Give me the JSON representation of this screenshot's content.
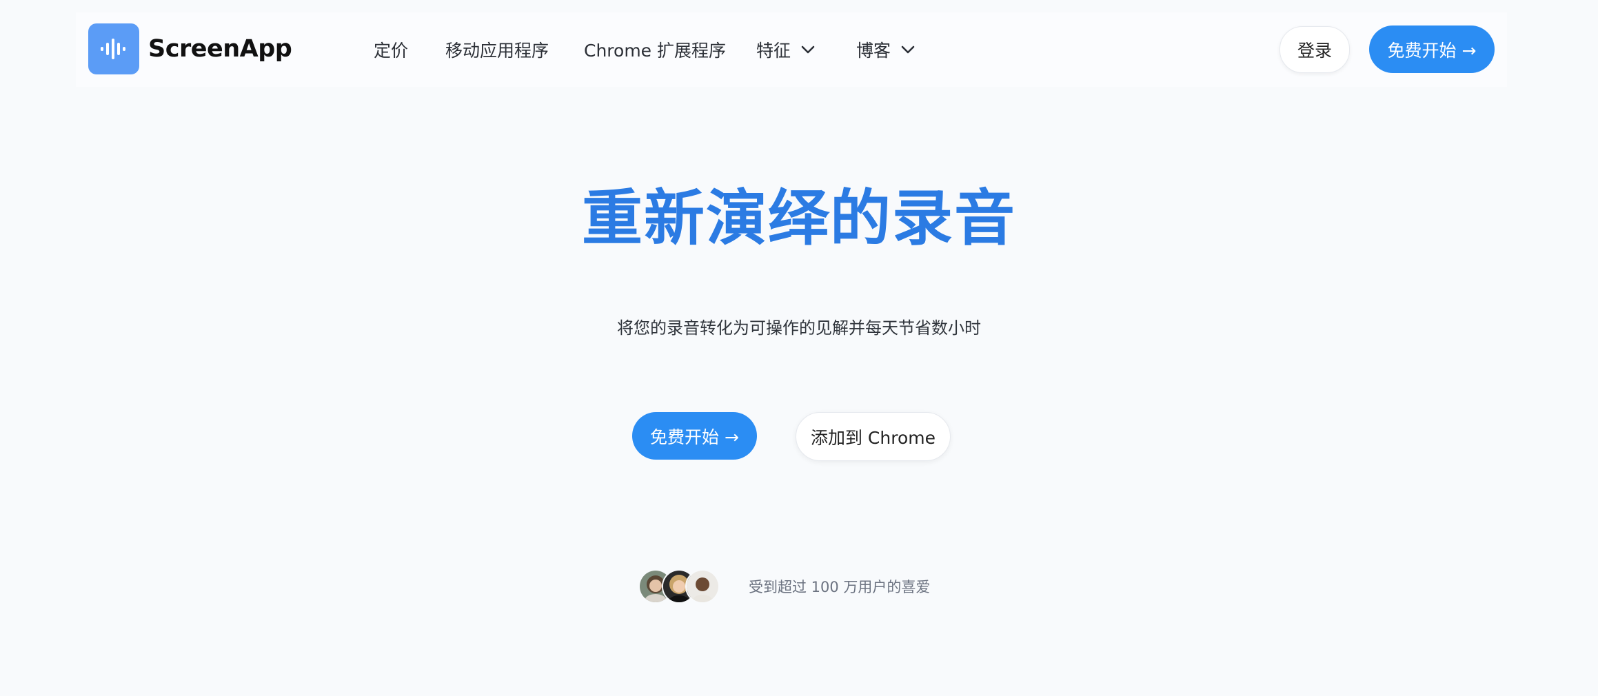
{
  "brand": {
    "name": "ScreenApp",
    "logo_icon": "waveform-icon",
    "logo_color": "#5b9cf6"
  },
  "nav": {
    "items": [
      {
        "label": "定价",
        "has_dropdown": false
      },
      {
        "label": "移动应用程序",
        "has_dropdown": false
      },
      {
        "label": "Chrome 扩展程序",
        "has_dropdown": false
      },
      {
        "label": "特征",
        "has_dropdown": true,
        "icon": "chevron-down-icon"
      },
      {
        "label": "博客",
        "has_dropdown": true,
        "icon": "chevron-down-icon"
      }
    ],
    "login_label": "登录",
    "start_label": "免费开始 →"
  },
  "hero": {
    "title": "重新演绎的录音",
    "subtitle": "将您的录音转化为可操作的见解并每天节省数小时",
    "primary_cta": "免费开始 →",
    "secondary_cta": "添加到 Chrome"
  },
  "social_proof": {
    "text": "受到超过 100 万用户的喜爱",
    "avatars": [
      "user-avatar-1",
      "user-avatar-2",
      "user-avatar-3"
    ]
  },
  "colors": {
    "accent": "#2b8df3",
    "title": "#2b7be3",
    "background": "#f8fafc"
  }
}
